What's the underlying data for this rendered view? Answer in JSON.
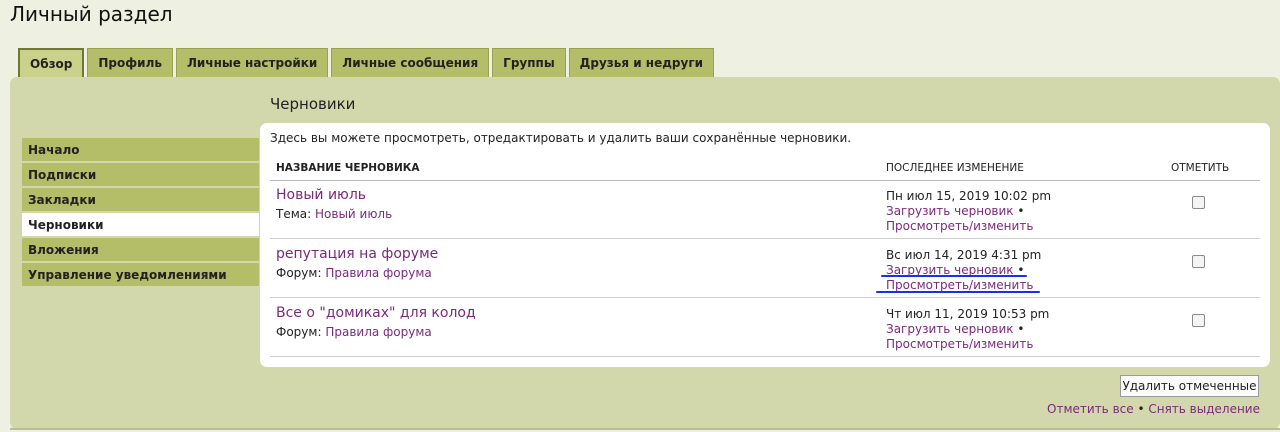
{
  "page": {
    "title": "Личный раздел"
  },
  "tabs": [
    {
      "label": "Обзор",
      "active": true
    },
    {
      "label": "Профиль"
    },
    {
      "label": "Личные настройки"
    },
    {
      "label": "Личные сообщения"
    },
    {
      "label": "Группы"
    },
    {
      "label": "Друзья и недруги"
    }
  ],
  "sidebar": {
    "items": [
      {
        "label": "Начало"
      },
      {
        "label": "Подписки"
      },
      {
        "label": "Закладки"
      },
      {
        "label": "Черновики",
        "active": true
      },
      {
        "label": "Вложения"
      },
      {
        "label": "Управление уведомлениями"
      }
    ]
  },
  "main": {
    "title": "Черновики",
    "description": "Здесь вы можете просмотреть, отредактировать и удалить ваши сохранённые черновики.",
    "columns": {
      "name": "Название черновика",
      "modified": "Последнее изменение",
      "mark": "Отметить"
    },
    "drafts": [
      {
        "title": "Новый июль",
        "meta_label": "Тема:",
        "meta_link": "Новый июль",
        "date": "Пн июл 15, 2019 10:02 pm",
        "load": "Загрузить черновик",
        "bullet": "•",
        "view": "Просмотреть/изменить"
      },
      {
        "title": "репутация на форуме",
        "meta_label": "Форум:",
        "meta_link": "Правила форума",
        "date": "Вс июл 14, 2019 4:31 pm",
        "load": "Загрузить черновик",
        "bullet": "•",
        "view": "Просмотреть/изменить"
      },
      {
        "title": "Все о \"домиках\" для колод",
        "meta_label": "Форум:",
        "meta_link": "Правила форума",
        "date": "Чт июл 11, 2019 10:53 pm",
        "load": "Загрузить черновик",
        "bullet": "•",
        "view": "Просмотреть/изменить"
      }
    ]
  },
  "footer": {
    "delete_button": "Удалить отмеченные",
    "mark_all": "Отметить все",
    "bullet": "•",
    "unmark_all": "Снять выделение"
  },
  "colors": {
    "tab": "#b4bd68",
    "panel": "#d3d8ac",
    "link": "#7a2a7a",
    "highlight": "#1133ee"
  }
}
